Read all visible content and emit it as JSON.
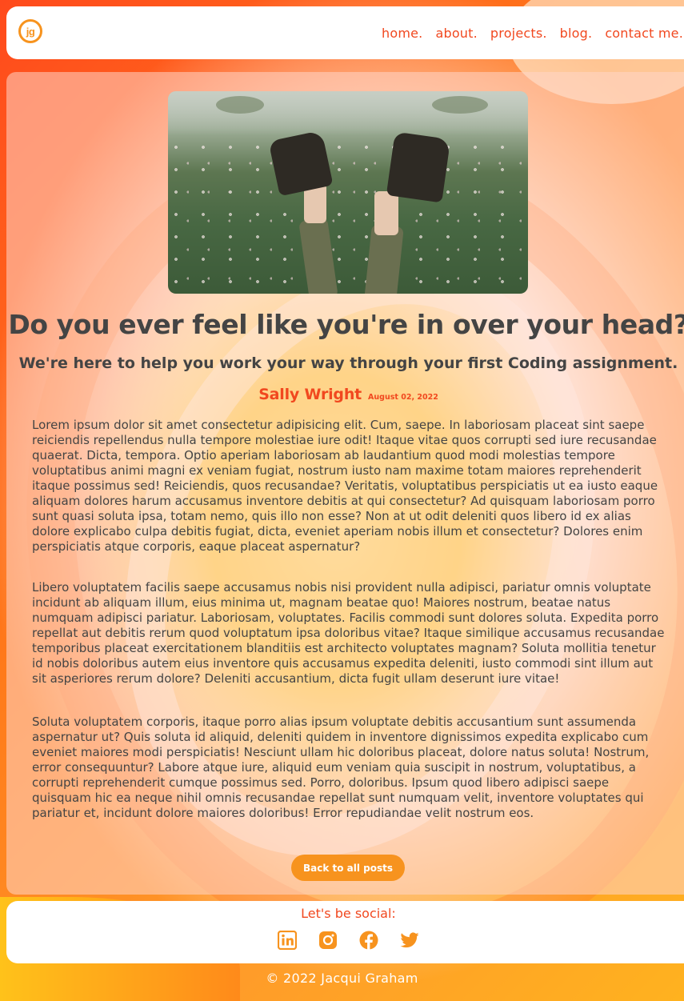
{
  "header": {
    "logo_text": "jg",
    "nav": [
      "home.",
      "about.",
      "projects.",
      "blog.",
      "contact me."
    ]
  },
  "post": {
    "title": "Do you ever feel like you're in over your head?",
    "subtitle": "We're here to help you work your way through your first Coding assignment.",
    "author": "Sally Wright",
    "date": "August 02, 2022",
    "paragraphs": [
      "Lorem ipsum dolor sit amet consectetur adipisicing elit. Cum, saepe. In laboriosam placeat sint saepe reiciendis repellendus nulla tempore molestiae iure odit! Itaque vitae quos corrupti sed iure recusandae quaerat. Dicta, tempora. Optio aperiam laboriosam ab laudantium quod modi molestias tempore voluptatibus animi magni ex veniam fugiat, nostrum iusto nam maxime totam maiores reprehenderit itaque possimus sed! Reiciendis, quos recusandae? Veritatis, voluptatibus perspiciatis ut ea iusto eaque aliquam dolores harum accusamus inventore debitis at qui consectetur? Ad quisquam laboriosam porro sunt quasi soluta ipsa, totam nemo, quis illo non esse? Non at ut odit deleniti quos libero id ex alias dolore explicabo culpa debitis fugiat, dicta, eveniet aperiam nobis illum et consectetur? Dolores enim perspiciatis atque corporis, eaque placeat aspernatur?",
      "Libero voluptatem facilis saepe accusamus nobis nisi provident nulla adipisci, pariatur omnis voluptate incidunt ab aliquam illum, eius minima ut, magnam beatae quo! Maiores nostrum, beatae natus numquam adipisci pariatur. Laboriosam, voluptates. Facilis commodi sunt dolores soluta. Expedita porro repellat aut debitis rerum quod voluptatum ipsa doloribus vitae? Itaque similique accusamus recusandae temporibus placeat exercitationem blanditiis est architecto voluptates magnam? Soluta mollitia tenetur id nobis doloribus autem eius inventore quis accusamus expedita deleniti, iusto commodi sint illum aut sit asperiores rerum dolore? Deleniti accusantium, dicta fugit ullam deserunt iure vitae!",
      "Soluta voluptatem corporis, itaque porro alias ipsum voluptate debitis accusantium sunt assumenda aspernatur ut? Quis soluta id aliquid, deleniti quidem in inventore dignissimos expedita explicabo cum eveniet maiores modi perspiciatis! Nesciunt ullam hic doloribus placeat, dolore natus soluta! Nostrum, error consequuntur? Labore atque iure, aliquid eum veniam quia suscipit in nostrum, voluptatibus, a corrupti reprehenderit cumque possimus sed. Porro, doloribus. Ipsum quod libero adipisci saepe quisquam hic ea neque nihil omnis recusandae repellat sunt numquam velit, inventore voluptates qui pariatur et, incidunt dolore maiores doloribus! Error repudiandae velit nostrum eos."
    ],
    "back_button": "Back to all posts"
  },
  "footer": {
    "social_title": "Let's be social:",
    "socials": [
      "linkedin-icon",
      "instagram-icon",
      "facebook-icon",
      "twitter-icon"
    ],
    "copyright": "© 2022 Jacqui Graham"
  },
  "colors": {
    "accent": "#f1481f",
    "button": "#f7931e",
    "text": "#444444"
  }
}
